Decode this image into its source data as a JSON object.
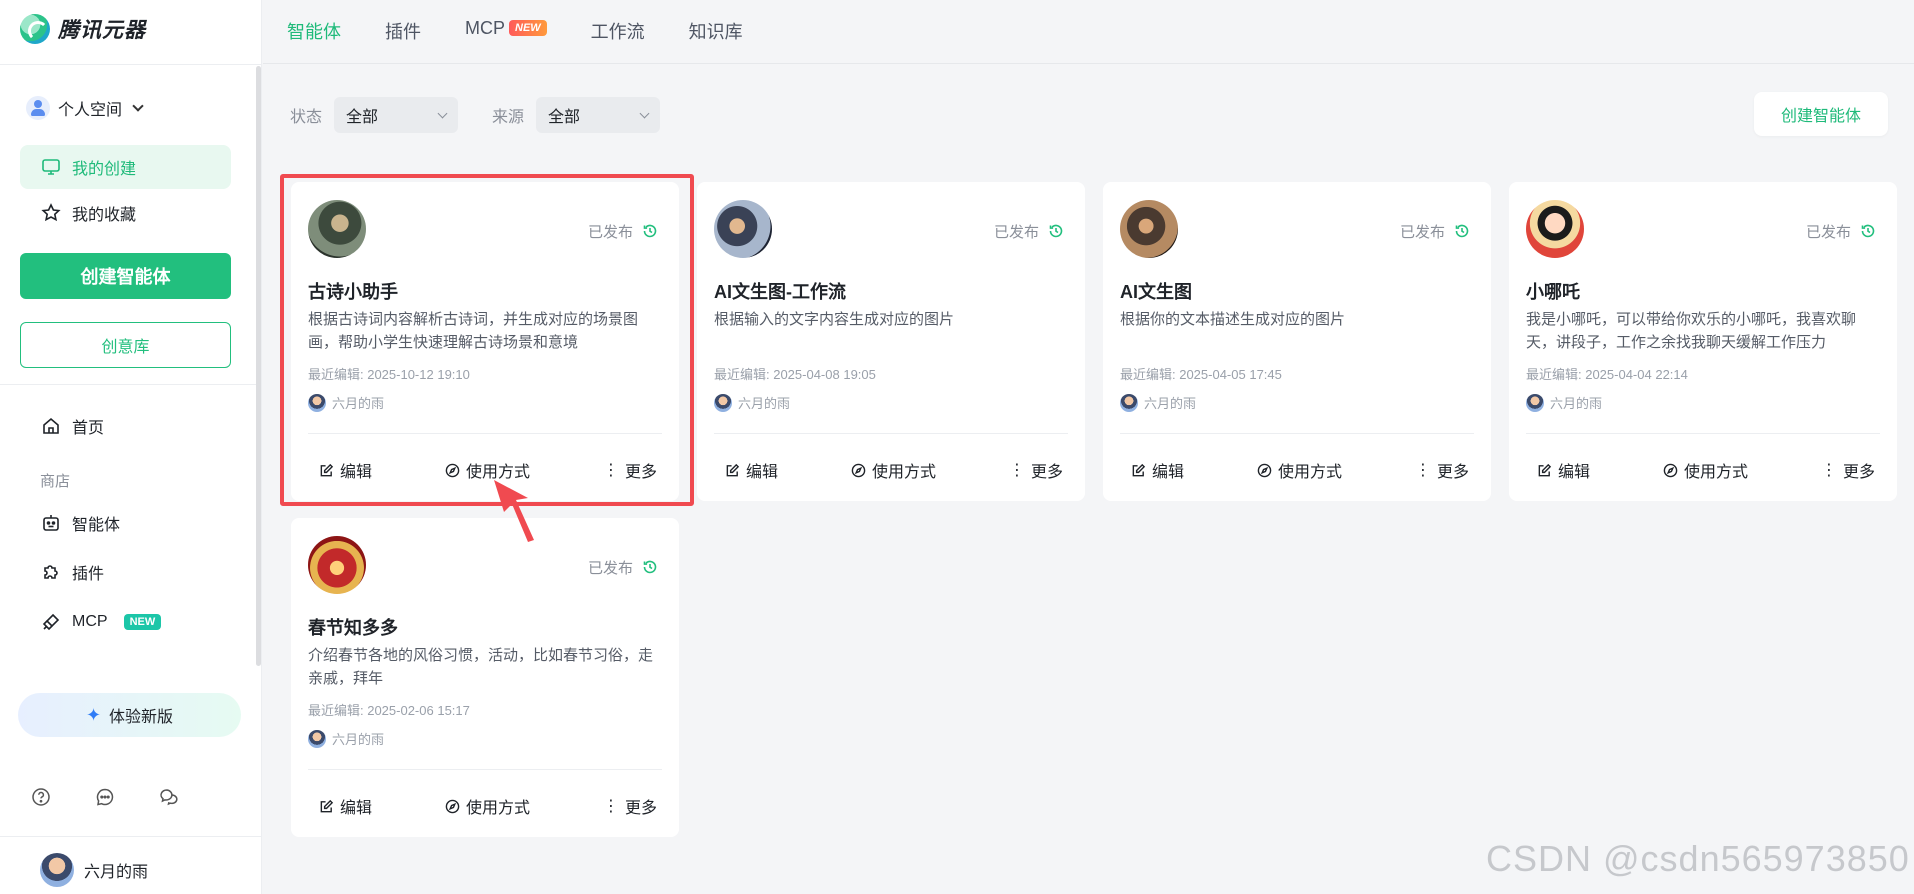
{
  "app": {
    "name": "腾讯元器"
  },
  "topnav": {
    "tabs": [
      {
        "label": "智能体",
        "active": true
      },
      {
        "label": "插件"
      },
      {
        "label": "MCP",
        "badge": "NEW"
      },
      {
        "label": "工作流"
      },
      {
        "label": "知识库"
      }
    ]
  },
  "sidebar": {
    "space_label": "个人空间",
    "my_created": "我的创建",
    "my_favorites": "我的收藏",
    "create_agent": "创建智能体",
    "idea_library": "创意库",
    "home": "首页",
    "store_section": "商店",
    "store_agents": "智能体",
    "store_plugins": "插件",
    "store_mcp": "MCP",
    "mcp_badge": "NEW",
    "try_new": "体验新版",
    "user_name": "六月的雨"
  },
  "filters": {
    "status_label": "状态",
    "status_value": "全部",
    "source_label": "来源",
    "source_value": "全部",
    "create_button": "创建智能体"
  },
  "cards": [
    {
      "title": "古诗小助手",
      "status": "已发布",
      "description": "根据古诗词内容解析古诗词，并生成对应的场景图画，帮助小学生快速理解古诗场景和意境",
      "last_edit": "最近编辑: 2025-10-12 19:10",
      "author": "六月的雨",
      "actions": {
        "edit": "编辑",
        "usage": "使用方式",
        "more": "更多"
      }
    },
    {
      "title": "AI文生图-工作流",
      "status": "已发布",
      "description": "根据输入的文字内容生成对应的图片",
      "last_edit": "最近编辑: 2025-04-08 19:05",
      "author": "六月的雨",
      "actions": {
        "edit": "编辑",
        "usage": "使用方式",
        "more": "更多"
      }
    },
    {
      "title": "AI文生图",
      "status": "已发布",
      "description": "根据你的文本描述生成对应的图片",
      "last_edit": "最近编辑: 2025-04-05 17:45",
      "author": "六月的雨",
      "actions": {
        "edit": "编辑",
        "usage": "使用方式",
        "more": "更多"
      }
    },
    {
      "title": "小哪吒",
      "status": "已发布",
      "description": "我是小哪吒，可以带给你欢乐的小哪吒，我喜欢聊天，讲段子，工作之余找我聊天缓解工作压力",
      "last_edit": "最近编辑: 2025-04-04 22:14",
      "author": "六月的雨",
      "actions": {
        "edit": "编辑",
        "usage": "使用方式",
        "more": "更多"
      }
    },
    {
      "title": "春节知多多",
      "status": "已发布",
      "description": "介绍春节各地的风俗习惯，活动，比如春节习俗，走亲戚，拜年",
      "last_edit": "最近编辑: 2025-02-06 15:17",
      "author": "六月的雨",
      "actions": {
        "edit": "编辑",
        "usage": "使用方式",
        "more": "更多"
      }
    }
  ],
  "watermark": "CSDN @csdn565973850",
  "colors": {
    "accent": "#22bf7e",
    "highlight": "#f04a50"
  }
}
